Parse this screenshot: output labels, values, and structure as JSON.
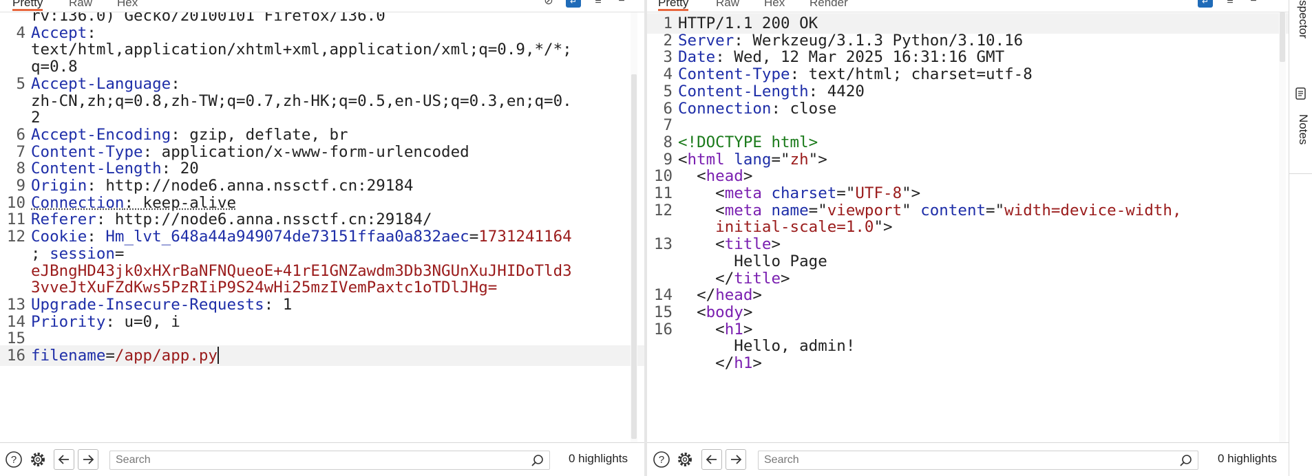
{
  "left_tabs": [
    "Pretty",
    "Raw",
    "Hex"
  ],
  "right_tabs": [
    "Pretty",
    "Raw",
    "Hex",
    "Render"
  ],
  "request": {
    "lines": [
      {
        "num": "",
        "parts": [
          {
            "t": "rv:136.0) Gecko/20100101 Firefox/136.0"
          }
        ]
      },
      {
        "num": "4",
        "parts": [
          {
            "t": "Accept",
            "c": "k"
          },
          {
            "t": ":"
          }
        ]
      },
      {
        "num": "",
        "parts": [
          {
            "t": "text/html,application/xhtml+xml,application/xml;q=0.9,*/*;"
          }
        ]
      },
      {
        "num": "",
        "parts": [
          {
            "t": "q=0.8"
          }
        ]
      },
      {
        "num": "5",
        "parts": [
          {
            "t": "Accept-Language",
            "c": "k"
          },
          {
            "t": ":"
          }
        ]
      },
      {
        "num": "",
        "parts": [
          {
            "t": "zh-CN,zh;q=0.8,zh-TW;q=0.7,zh-HK;q=0.5,en-US;q=0.3,en;q=0."
          }
        ]
      },
      {
        "num": "",
        "parts": [
          {
            "t": "2"
          }
        ]
      },
      {
        "num": "6",
        "parts": [
          {
            "t": "Accept-Encoding",
            "c": "k"
          },
          {
            "t": ": gzip, deflate, br"
          }
        ]
      },
      {
        "num": "7",
        "parts": [
          {
            "t": "Content-Type",
            "c": "k"
          },
          {
            "t": ": application/x-www-form-urlencoded"
          }
        ]
      },
      {
        "num": "8",
        "parts": [
          {
            "t": "Content-Length",
            "c": "k"
          },
          {
            "t": ": 20"
          }
        ]
      },
      {
        "num": "9",
        "parts": [
          {
            "t": "Origin",
            "c": "k"
          },
          {
            "t": ": http://node6.anna.nssctf.cn:29184"
          }
        ]
      },
      {
        "num": "10",
        "parts": [
          {
            "t": "Connection",
            "c": "k u"
          },
          {
            "t": ": keep-alive",
            "c": "u"
          }
        ]
      },
      {
        "num": "11",
        "parts": [
          {
            "t": "Referer",
            "c": "k"
          },
          {
            "t": ": http://node6.anna.nssctf.cn:29184/"
          }
        ]
      },
      {
        "num": "12",
        "parts": [
          {
            "t": "Cookie",
            "c": "k"
          },
          {
            "t": ": "
          },
          {
            "t": "Hm_lvt_648a44a949074de73151ffaa0a832aec",
            "c": "k"
          },
          {
            "t": "="
          },
          {
            "t": "1731241164",
            "c": "v"
          }
        ]
      },
      {
        "num": "",
        "parts": [
          {
            "t": "; "
          },
          {
            "t": "session",
            "c": "k"
          },
          {
            "t": "="
          }
        ]
      },
      {
        "num": "",
        "parts": [
          {
            "t": "eJBngHD43jk0xHXrBaNFNQueoE+41rE1GNZawdm3Db3NGUnXuJHIDoTld3",
            "c": "v"
          }
        ]
      },
      {
        "num": "",
        "parts": [
          {
            "t": "3vveJtXuFZdKws5PzRIiP9S24wHi25mzIVemPaxtc1oTDlJHg=",
            "c": "v"
          }
        ]
      },
      {
        "num": "13",
        "parts": [
          {
            "t": "Upgrade-Insecure-Requests",
            "c": "k"
          },
          {
            "t": ": 1"
          }
        ]
      },
      {
        "num": "14",
        "parts": [
          {
            "t": "Priority",
            "c": "k"
          },
          {
            "t": ": u=0, i"
          }
        ]
      },
      {
        "num": "15",
        "parts": []
      },
      {
        "num": "16",
        "parts": [
          {
            "t": "filename",
            "c": "k"
          },
          {
            "t": "="
          },
          {
            "t": "/app/app.py",
            "c": "v"
          }
        ],
        "highlight": true,
        "caret": true
      }
    ]
  },
  "response": {
    "lines": [
      {
        "num": "1",
        "parts": [
          {
            "t": "HTTP/1.1 200 OK"
          }
        ],
        "highlight": true
      },
      {
        "num": "2",
        "parts": [
          {
            "t": "Server",
            "c": "k"
          },
          {
            "t": ": Werkzeug/3.1.3 Python/3.10.16"
          }
        ]
      },
      {
        "num": "3",
        "parts": [
          {
            "t": "Date",
            "c": "k"
          },
          {
            "t": ": Wed, 12 Mar 2025 16:31:16 GMT"
          }
        ]
      },
      {
        "num": "4",
        "parts": [
          {
            "t": "Content-Type",
            "c": "k"
          },
          {
            "t": ": text/html; charset=utf-8"
          }
        ]
      },
      {
        "num": "5",
        "parts": [
          {
            "t": "Content-Length",
            "c": "k"
          },
          {
            "t": ": 4420"
          }
        ]
      },
      {
        "num": "6",
        "parts": [
          {
            "t": "Connection",
            "c": "k"
          },
          {
            "t": ": close"
          }
        ]
      },
      {
        "num": "7",
        "parts": []
      },
      {
        "num": "8",
        "parts": [
          {
            "t": "<!DOCTYPE html>",
            "c": "dt"
          }
        ]
      },
      {
        "num": "9",
        "parts": [
          {
            "t": "<"
          },
          {
            "t": "html",
            "c": "tg"
          },
          {
            "t": " "
          },
          {
            "t": "lang",
            "c": "k"
          },
          {
            "t": "=\""
          },
          {
            "t": "zh",
            "c": "v"
          },
          {
            "t": "\">"
          }
        ]
      },
      {
        "num": "10",
        "parts": [
          {
            "t": "  <"
          },
          {
            "t": "head",
            "c": "tg"
          },
          {
            "t": ">"
          }
        ]
      },
      {
        "num": "11",
        "parts": [
          {
            "t": "    <"
          },
          {
            "t": "meta",
            "c": "tg"
          },
          {
            "t": " "
          },
          {
            "t": "charset",
            "c": "k"
          },
          {
            "t": "=\""
          },
          {
            "t": "UTF-8",
            "c": "v"
          },
          {
            "t": "\">"
          }
        ]
      },
      {
        "num": "12",
        "parts": [
          {
            "t": "    <"
          },
          {
            "t": "meta",
            "c": "tg"
          },
          {
            "t": " "
          },
          {
            "t": "name",
            "c": "k"
          },
          {
            "t": "=\""
          },
          {
            "t": "viewport",
            "c": "v"
          },
          {
            "t": "\" "
          },
          {
            "t": "content",
            "c": "k"
          },
          {
            "t": "=\""
          },
          {
            "t": "width=device-width,",
            "c": "v"
          }
        ]
      },
      {
        "num": "",
        "parts": [
          {
            "t": "    "
          },
          {
            "t": "initial-scale=1.0",
            "c": "v"
          },
          {
            "t": "\">"
          }
        ]
      },
      {
        "num": "13",
        "parts": [
          {
            "t": "    <"
          },
          {
            "t": "title",
            "c": "tg"
          },
          {
            "t": ">"
          }
        ]
      },
      {
        "num": "",
        "parts": [
          {
            "t": "      Hello Page"
          }
        ]
      },
      {
        "num": "",
        "parts": [
          {
            "t": "    </"
          },
          {
            "t": "title",
            "c": "tg"
          },
          {
            "t": ">"
          }
        ]
      },
      {
        "num": "14",
        "parts": [
          {
            "t": "  </"
          },
          {
            "t": "head",
            "c": "tg"
          },
          {
            "t": ">"
          }
        ]
      },
      {
        "num": "15",
        "parts": [
          {
            "t": "  <"
          },
          {
            "t": "body",
            "c": "tg"
          },
          {
            "t": ">"
          }
        ]
      },
      {
        "num": "16",
        "parts": [
          {
            "t": "    <"
          },
          {
            "t": "h1",
            "c": "tg"
          },
          {
            "t": ">"
          }
        ]
      },
      {
        "num": "",
        "parts": [
          {
            "t": "      Hello, admin!"
          }
        ]
      },
      {
        "num": "",
        "parts": [
          {
            "t": "    </"
          },
          {
            "t": "h1",
            "c": "tg"
          },
          {
            "t": ">"
          }
        ]
      }
    ]
  },
  "left_bottom": {
    "search_placeholder": "Search",
    "highlights": "0 highlights"
  },
  "right_bottom": {
    "search_placeholder": "Search",
    "highlights": "0 highlights"
  },
  "side_tabs": {
    "inspector": "Inspector",
    "notes": "Notes"
  }
}
